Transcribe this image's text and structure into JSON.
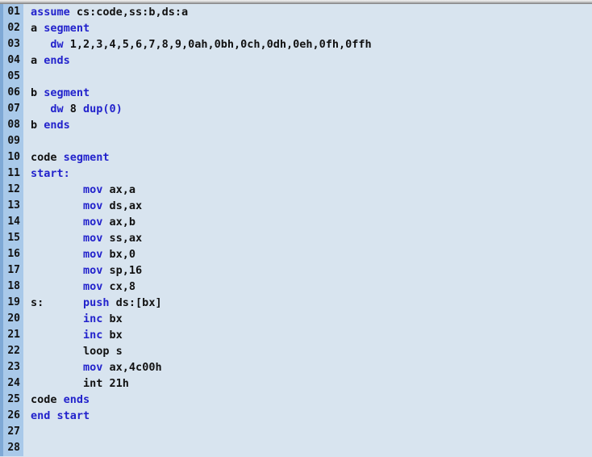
{
  "window": {
    "title_strip": "",
    "background_color": "#d8e4ef",
    "gutter_color": "#a9c9e9",
    "gutter_border_color": "#7fa9d6",
    "keyword_color": "#2222cc",
    "text_color": "#111111"
  },
  "editor": {
    "total_lines": 28,
    "language": "x86 assembly",
    "lines": [
      {
        "num": "01",
        "tokens": [
          {
            "t": "assume",
            "c": "kw"
          },
          {
            "t": " cs:code,ss:b,ds:a",
            "c": "op"
          }
        ]
      },
      {
        "num": "02",
        "tokens": [
          {
            "t": "a ",
            "c": "op"
          },
          {
            "t": "segment",
            "c": "kw"
          }
        ]
      },
      {
        "num": "03",
        "tokens": [
          {
            "t": "   ",
            "c": "op"
          },
          {
            "t": "dw",
            "c": "kw"
          },
          {
            "t": " 1,2,3,4,5,6,7,8,9,0ah,0bh,0ch,0dh,0eh,0fh,0ffh",
            "c": "op"
          }
        ]
      },
      {
        "num": "04",
        "tokens": [
          {
            "t": "a ",
            "c": "op"
          },
          {
            "t": "ends",
            "c": "kw"
          }
        ]
      },
      {
        "num": "05",
        "tokens": [
          {
            "t": "",
            "c": "op"
          }
        ]
      },
      {
        "num": "06",
        "tokens": [
          {
            "t": "b ",
            "c": "op"
          },
          {
            "t": "segment",
            "c": "kw"
          }
        ]
      },
      {
        "num": "07",
        "tokens": [
          {
            "t": "   ",
            "c": "op"
          },
          {
            "t": "dw",
            "c": "kw"
          },
          {
            "t": " 8 ",
            "c": "op"
          },
          {
            "t": "dup(0)",
            "c": "kw"
          }
        ]
      },
      {
        "num": "08",
        "tokens": [
          {
            "t": "b ",
            "c": "op"
          },
          {
            "t": "ends",
            "c": "kw"
          }
        ]
      },
      {
        "num": "09",
        "tokens": [
          {
            "t": "",
            "c": "op"
          }
        ]
      },
      {
        "num": "10",
        "tokens": [
          {
            "t": "code ",
            "c": "op"
          },
          {
            "t": "segment",
            "c": "kw"
          }
        ]
      },
      {
        "num": "11",
        "tokens": [
          {
            "t": "start:",
            "c": "kw"
          }
        ]
      },
      {
        "num": "12",
        "tokens": [
          {
            "t": "        ",
            "c": "op"
          },
          {
            "t": "mov",
            "c": "kw"
          },
          {
            "t": " ax,a",
            "c": "op"
          }
        ]
      },
      {
        "num": "13",
        "tokens": [
          {
            "t": "        ",
            "c": "op"
          },
          {
            "t": "mov",
            "c": "kw"
          },
          {
            "t": " ds,ax",
            "c": "op"
          }
        ]
      },
      {
        "num": "14",
        "tokens": [
          {
            "t": "        ",
            "c": "op"
          },
          {
            "t": "mov",
            "c": "kw"
          },
          {
            "t": " ax,b",
            "c": "op"
          }
        ]
      },
      {
        "num": "15",
        "tokens": [
          {
            "t": "        ",
            "c": "op"
          },
          {
            "t": "mov",
            "c": "kw"
          },
          {
            "t": " ss,ax",
            "c": "op"
          }
        ]
      },
      {
        "num": "16",
        "tokens": [
          {
            "t": "        ",
            "c": "op"
          },
          {
            "t": "mov",
            "c": "kw"
          },
          {
            "t": " bx,0",
            "c": "op"
          }
        ]
      },
      {
        "num": "17",
        "tokens": [
          {
            "t": "        ",
            "c": "op"
          },
          {
            "t": "mov",
            "c": "kw"
          },
          {
            "t": " sp,16",
            "c": "op"
          }
        ]
      },
      {
        "num": "18",
        "tokens": [
          {
            "t": "        ",
            "c": "op"
          },
          {
            "t": "mov",
            "c": "kw"
          },
          {
            "t": " cx,8",
            "c": "op"
          }
        ]
      },
      {
        "num": "19",
        "tokens": [
          {
            "t": "s:      ",
            "c": "op"
          },
          {
            "t": "push",
            "c": "kw"
          },
          {
            "t": " ds:[bx]",
            "c": "op"
          }
        ]
      },
      {
        "num": "20",
        "tokens": [
          {
            "t": "        ",
            "c": "op"
          },
          {
            "t": "inc",
            "c": "kw"
          },
          {
            "t": " bx",
            "c": "op"
          }
        ]
      },
      {
        "num": "21",
        "tokens": [
          {
            "t": "        ",
            "c": "op"
          },
          {
            "t": "inc",
            "c": "kw"
          },
          {
            "t": " bx",
            "c": "op"
          }
        ]
      },
      {
        "num": "22",
        "tokens": [
          {
            "t": "        loop s",
            "c": "op"
          }
        ]
      },
      {
        "num": "23",
        "tokens": [
          {
            "t": "        ",
            "c": "op"
          },
          {
            "t": "mov",
            "c": "kw"
          },
          {
            "t": " ax,4c00h",
            "c": "op"
          }
        ]
      },
      {
        "num": "24",
        "tokens": [
          {
            "t": "        int 21h",
            "c": "op"
          }
        ]
      },
      {
        "num": "25",
        "tokens": [
          {
            "t": "code ",
            "c": "op"
          },
          {
            "t": "ends",
            "c": "kw"
          }
        ]
      },
      {
        "num": "26",
        "tokens": [
          {
            "t": "end start",
            "c": "kw"
          }
        ]
      },
      {
        "num": "27",
        "tokens": [
          {
            "t": "",
            "c": "op"
          }
        ]
      },
      {
        "num": "28",
        "tokens": [
          {
            "t": "",
            "c": "op"
          }
        ]
      }
    ]
  }
}
